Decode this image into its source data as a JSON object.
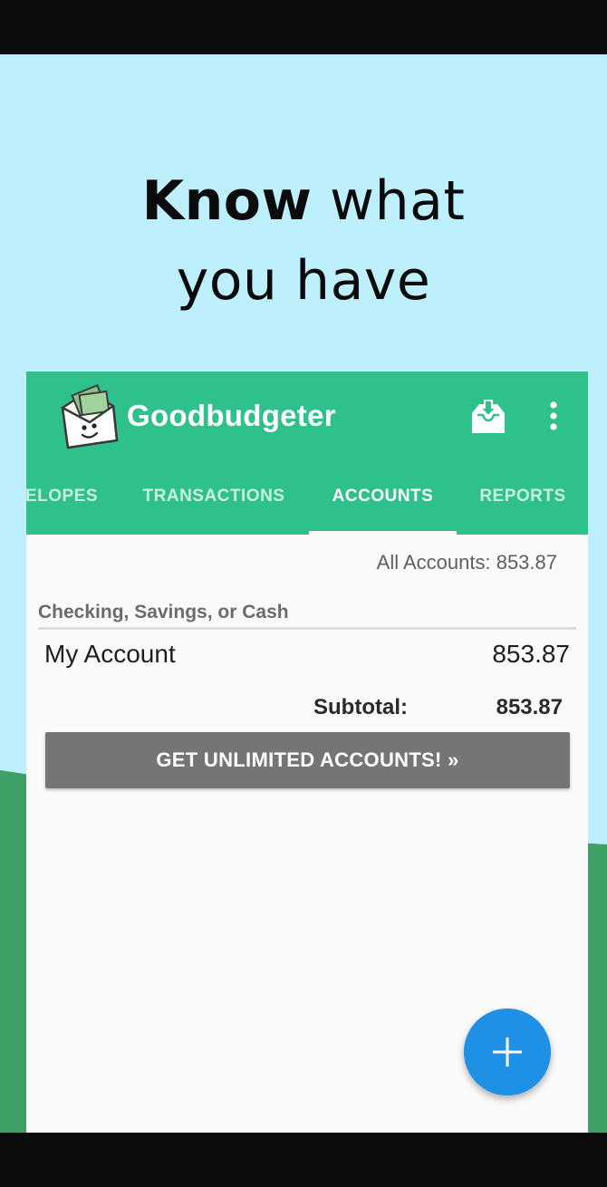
{
  "headline": {
    "bold": "Know",
    "rest_line1": "what",
    "line2": "you have"
  },
  "app": {
    "title": "Goodbudgeter",
    "icons": {
      "logo": "goodbudget-envelope-logo",
      "import": "tray-download-icon",
      "more": "more-vertical-icon",
      "fab": "plus-icon"
    },
    "tabs": [
      {
        "label": "ELOPES",
        "active": false
      },
      {
        "label": "TRANSACTIONS",
        "active": false
      },
      {
        "label": "ACCOUNTS",
        "active": true
      },
      {
        "label": "REPORTS",
        "active": false
      }
    ],
    "all_accounts": "All Accounts: 853.87",
    "section_title": "Checking, Savings, or Cash",
    "account": {
      "name": "My Account",
      "amount": "853.87"
    },
    "subtotal": {
      "label": "Subtotal:",
      "amount": "853.87"
    },
    "cta_button": "GET UNLIMITED ACCOUNTS! »"
  },
  "colors": {
    "sky": "#bdeffd",
    "hill": "#3ea067",
    "appbar": "#2ec18c",
    "fab": "#1e90e6",
    "cta": "#757575"
  }
}
